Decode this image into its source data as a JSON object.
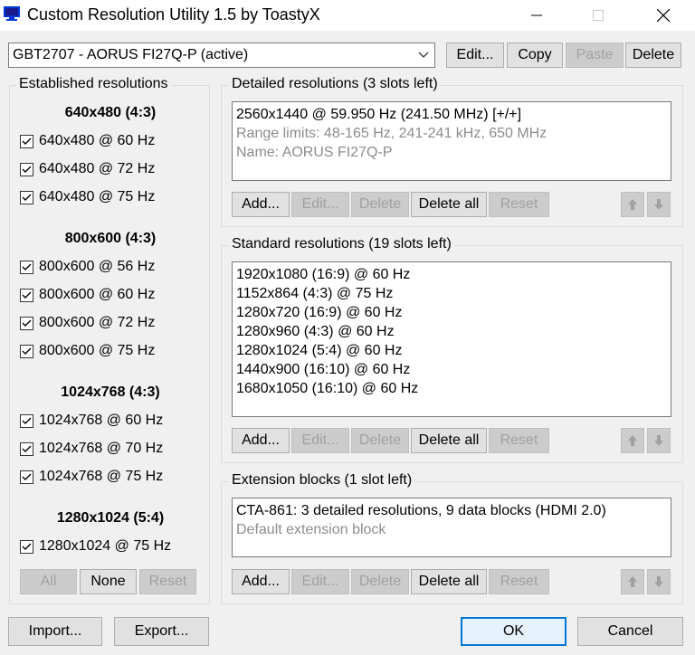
{
  "window": {
    "title": "Custom Resolution Utility 1.5 by ToastyX"
  },
  "monitor": {
    "selected": "GBT2707 - AORUS FI27Q-P (active)"
  },
  "top_buttons": {
    "edit": "Edit...",
    "copy": "Copy",
    "paste": "Paste",
    "delete": "Delete"
  },
  "established": {
    "legend": "Established resolutions",
    "groups": [
      {
        "heading": "640x480 (4:3)",
        "items": [
          "640x480 @ 60 Hz",
          "640x480 @ 72 Hz",
          "640x480 @ 75 Hz"
        ]
      },
      {
        "heading": "800x600 (4:3)",
        "items": [
          "800x600 @ 56 Hz",
          "800x600 @ 60 Hz",
          "800x600 @ 72 Hz",
          "800x600 @ 75 Hz"
        ]
      },
      {
        "heading": "1024x768 (4:3)",
        "items": [
          "1024x768 @ 60 Hz",
          "1024x768 @ 70 Hz",
          "1024x768 @ 75 Hz"
        ]
      },
      {
        "heading": "1280x1024 (5:4)",
        "items": [
          "1280x1024 @ 75 Hz"
        ]
      }
    ],
    "buttons": {
      "all": "All",
      "none": "None",
      "reset": "Reset"
    }
  },
  "detailed": {
    "legend": "Detailed resolutions (3 slots left)",
    "lines": [
      {
        "text": "2560x1440 @ 59.950 Hz (241.50 MHz) [+/+]",
        "gray": false
      },
      {
        "text": "Range limits: 48-165 Hz, 241-241 kHz, 650 MHz",
        "gray": true
      },
      {
        "text": "Name: AORUS FI27Q-P",
        "gray": true
      }
    ]
  },
  "standard": {
    "legend": "Standard resolutions (19 slots left)",
    "lines": [
      "1920x1080 (16:9) @ 60 Hz",
      "1152x864 (4:3) @ 75 Hz",
      "1280x720 (16:9) @ 60 Hz",
      "1280x960 (4:3) @ 60 Hz",
      "1280x1024 (5:4) @ 60 Hz",
      "1440x900 (16:10) @ 60 Hz",
      "1680x1050 (16:10) @ 60 Hz"
    ]
  },
  "extension": {
    "legend": "Extension blocks (1 slot left)",
    "lines": [
      {
        "text": "CTA-861: 3 detailed resolutions, 9 data blocks (HDMI 2.0)",
        "gray": false
      },
      {
        "text": "Default extension block",
        "gray": true
      }
    ]
  },
  "section_buttons": {
    "add": "Add...",
    "edit": "Edit...",
    "delete": "Delete",
    "delete_all": "Delete all",
    "reset": "Reset"
  },
  "bottom_buttons": {
    "import": "Import...",
    "export": "Export...",
    "ok": "OK",
    "cancel": "Cancel"
  },
  "colors": {
    "accent": "#0078d7",
    "icon_blue": "#0037da"
  }
}
